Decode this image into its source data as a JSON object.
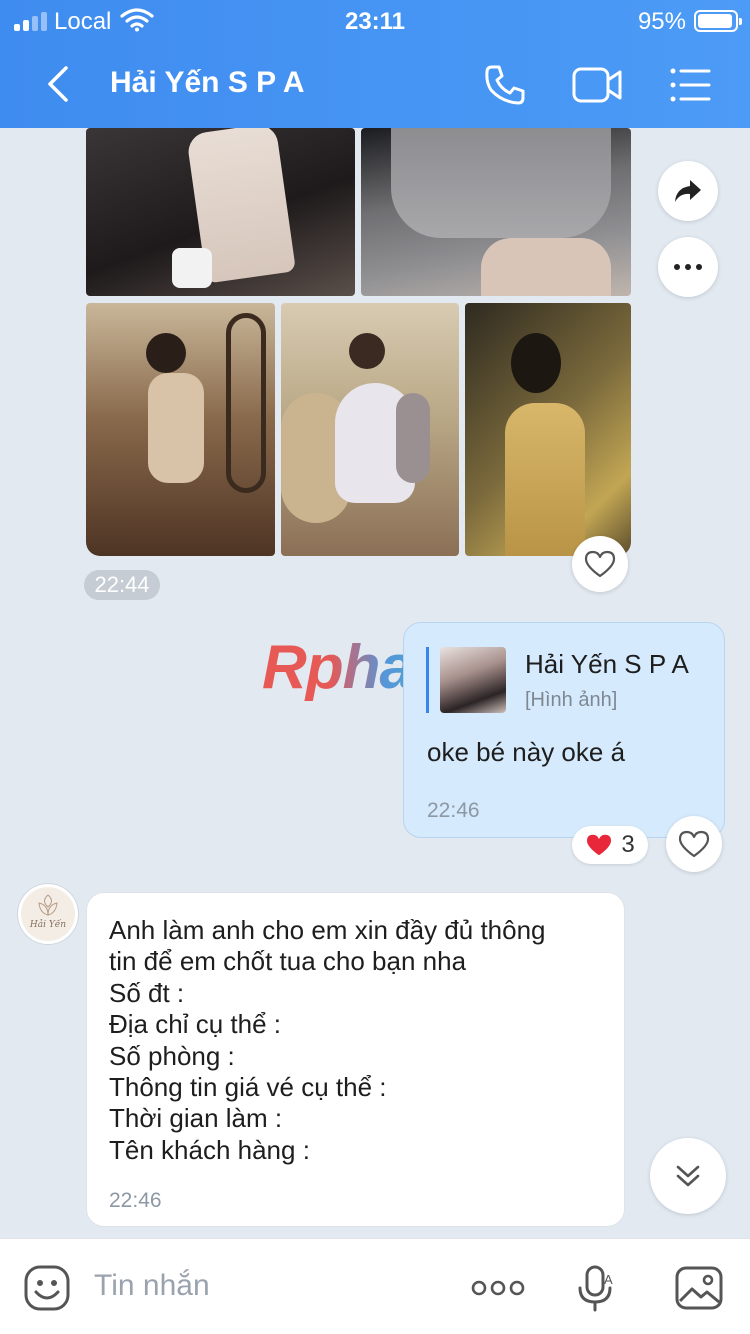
{
  "status_bar": {
    "carrier": "Local",
    "time": "23:11",
    "battery_percent": "95%",
    "battery_level": 0.95
  },
  "header": {
    "title": "Hải Yến S P A",
    "icons": [
      "back-arrow-icon",
      "phone-icon",
      "video-call-icon",
      "menu-list-icon"
    ]
  },
  "image_group": {
    "time": "22:44",
    "side_actions": [
      "share-icon",
      "more-icon"
    ]
  },
  "watermark": {
    "text": "Rphang"
  },
  "outgoing_message": {
    "quote_name": "Hải Yến S P A",
    "quote_type": "[Hình ảnh]",
    "text": "oke bé này oke á",
    "time": "22:46",
    "reaction_count": "3",
    "reaction_color": "#e8283a"
  },
  "incoming_message": {
    "lines": [
      "Anh làm anh cho em xin đầy đủ thông",
      "tin để em chốt tua cho bạn nha",
      "Số đt :",
      "Địa chỉ cụ thể :",
      "Số phòng :",
      "Thông tin giá vé cụ thể :",
      "Thời gian làm :",
      "Tên khách hàng :"
    ],
    "time": "22:46",
    "avatar_text": "Hải Yến"
  },
  "composer": {
    "placeholder": "Tin nhắn",
    "icons": [
      "sticker-icon",
      "more-dots-icon",
      "voice-icon",
      "image-icon"
    ]
  },
  "colors": {
    "header": "#4592f2",
    "background": "#e2e9f1",
    "outgoing_bubble": "#d5eafc",
    "accent": "#3a86e8"
  }
}
